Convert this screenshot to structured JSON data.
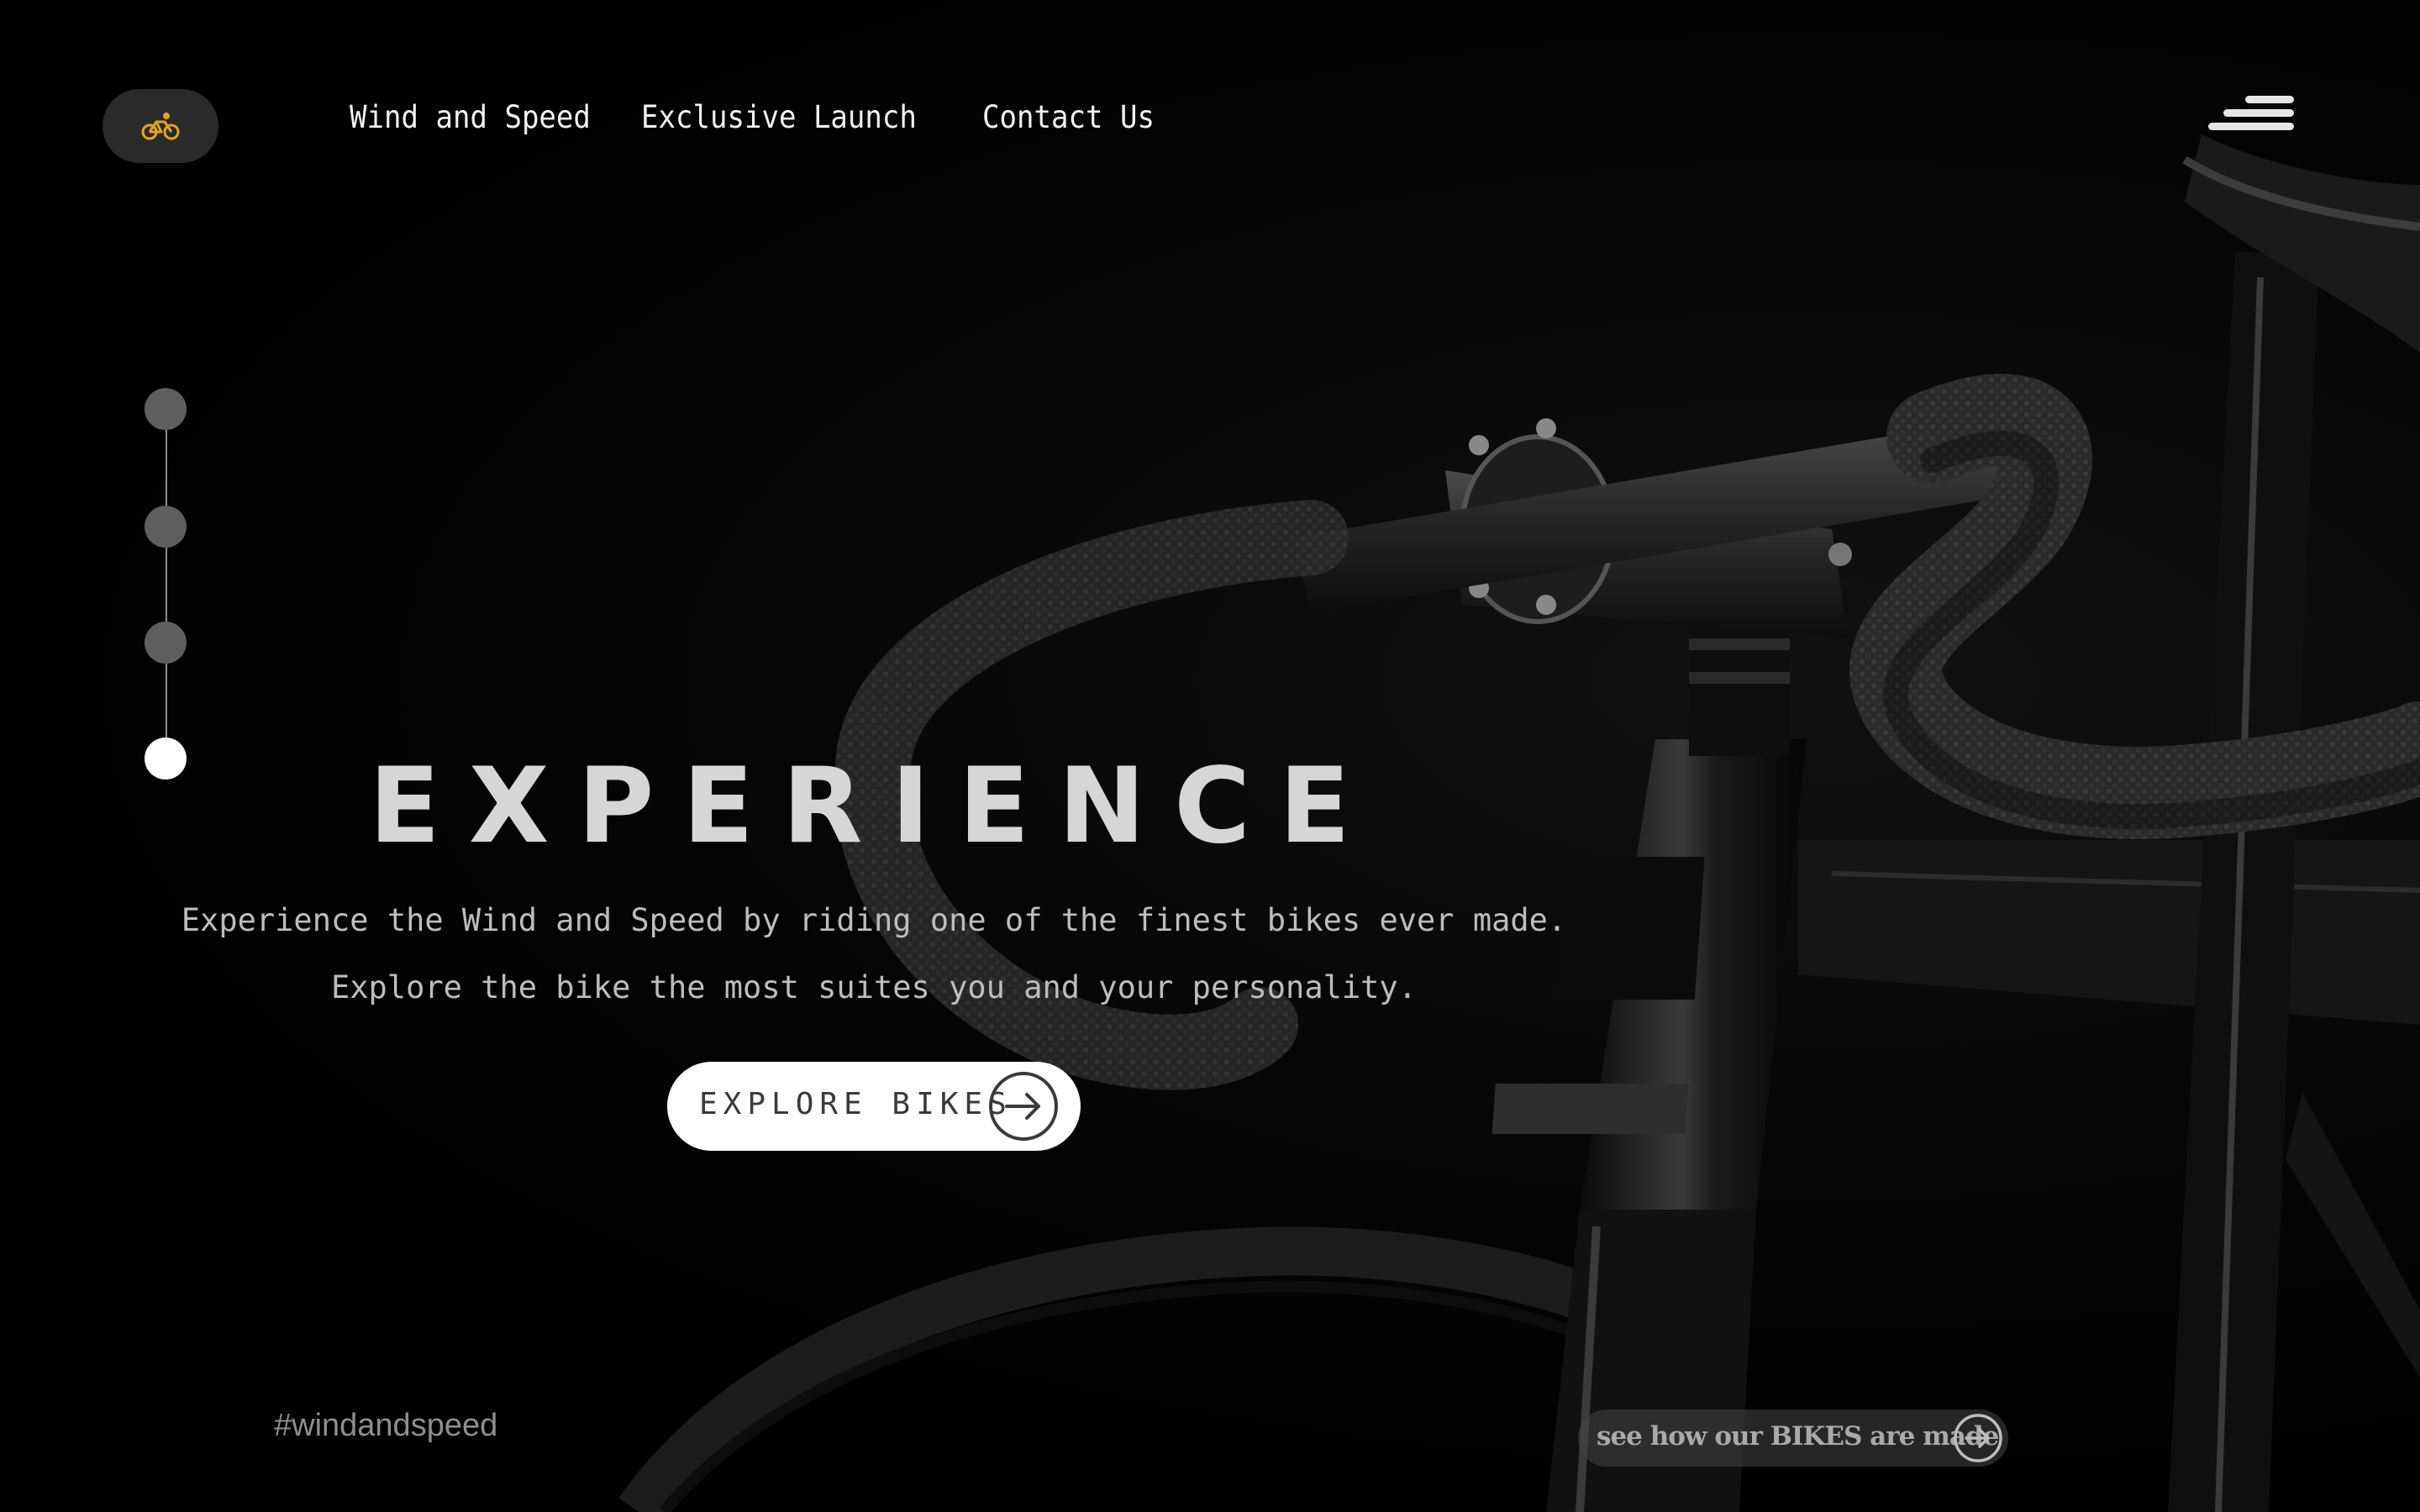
{
  "header": {
    "logo_icon": "cyclist-icon",
    "logo_color": "#e8a21c",
    "nav": [
      {
        "label": "Wind and Speed"
      },
      {
        "label": "Exclusive Launch"
      },
      {
        "label": "Contact Us"
      }
    ],
    "menu_icon": "hamburger-menu-icon"
  },
  "stepper": {
    "total": 4,
    "active_index": 3
  },
  "hero": {
    "title": "EXPERIENCE",
    "subtitle_line1": "Experience the Wind and Speed by riding one of the finest bikes ever made.",
    "subtitle_line2": "Explore the bike the most suites you and your personality.",
    "cta_label": "EXPLORE BIKES",
    "cta_icon": "arrow-right-circle-icon"
  },
  "footer": {
    "hashtag": "#windandspeed",
    "made_label": "see how our BIKES are made",
    "made_icon": "arrow-right-circle-icon"
  },
  "colors": {
    "background": "#000000",
    "accent": "#e8a21c",
    "title": "#d6d6d6",
    "button_bg": "#ffffff"
  }
}
